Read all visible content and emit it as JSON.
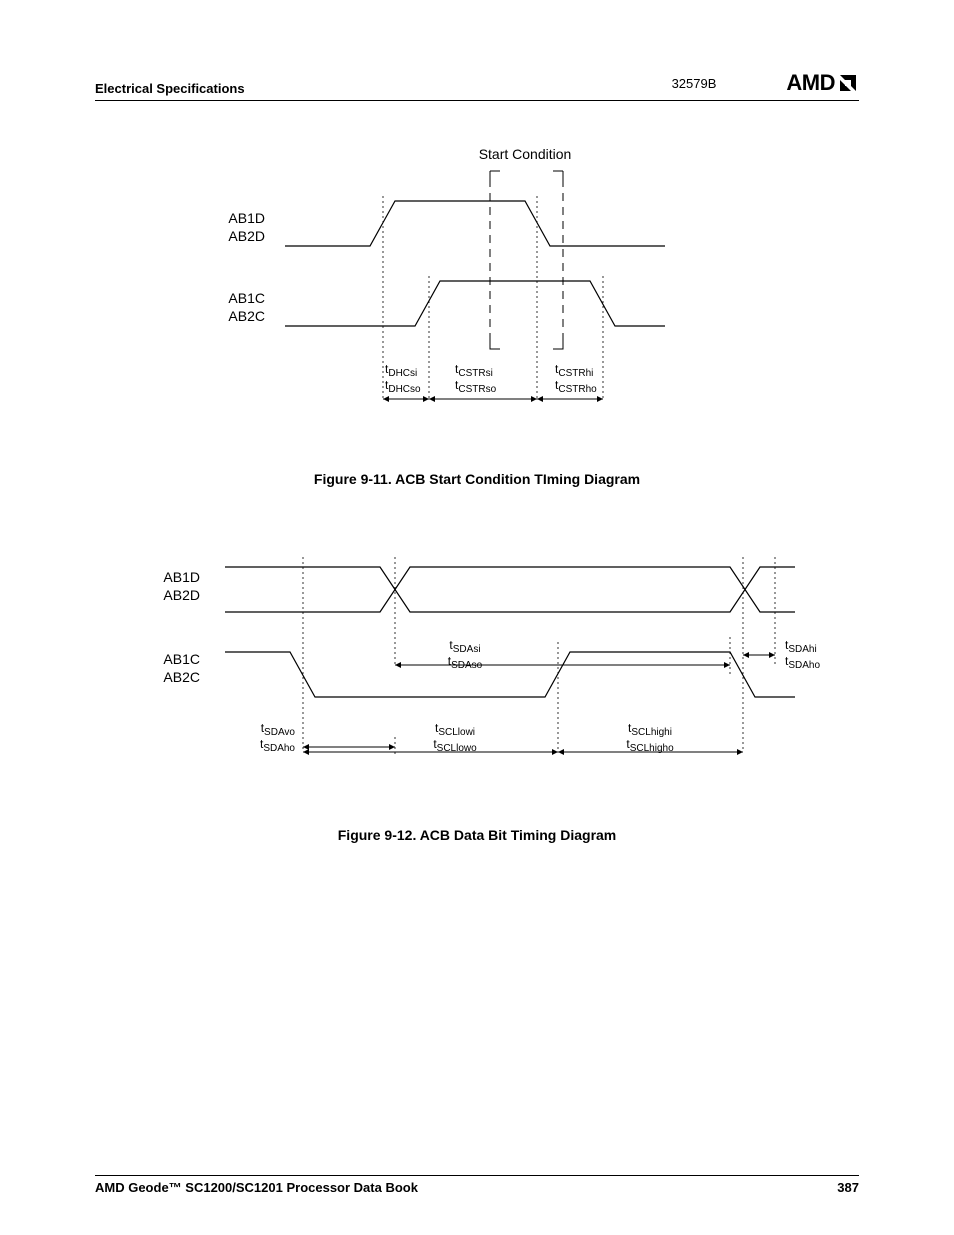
{
  "header": {
    "section": "Electrical Specifications",
    "docnum": "32579B",
    "brand": "AMD"
  },
  "figure1": {
    "caption": "Figure 9-11.  ACB Start Condition TIming Diagram",
    "title_top": "Start Condition",
    "signals": {
      "d1": "AB1D",
      "d2": "AB2D",
      "c1": "AB1C",
      "c2": "AB2C"
    },
    "labels": {
      "dhcsi": "DHCsi",
      "dhcso": "DHCso",
      "cstrsi": "CSTRsi",
      "cstrso": "CSTRso",
      "cstrhi": "CSTRhi",
      "cstrho": "CSTRho"
    }
  },
  "figure2": {
    "caption": "Figure 9-12.  ACB Data Bit Timing Diagram",
    "signals": {
      "d1": "AB1D",
      "d2": "AB2D",
      "c1": "AB1C",
      "c2": "AB2C"
    },
    "labels": {
      "sdasi": "SDAsi",
      "sdaso": "SDAso",
      "sdahi": "SDAhi",
      "sdaho": "SDAho",
      "sdavo": "SDAvo",
      "scllowi": "SCLlowi",
      "scllowo": "SCLlowo",
      "sclhighi": "SCLhighi",
      "sclhigho": "SCLhigho"
    }
  },
  "t_prefix": "t",
  "footer": {
    "book": "AMD Geode™ SC1200/SC1201 Processor Data Book",
    "page": "387"
  }
}
